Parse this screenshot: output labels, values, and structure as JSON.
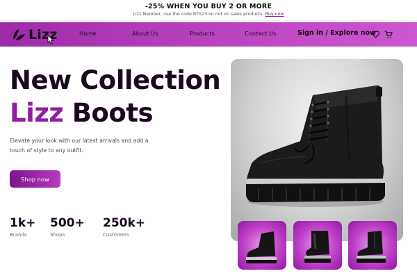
{
  "promo": {
    "title": "-25% WHEN YOU BUY 2 OR MORE",
    "message": "Lizz Member, use the code BTS23 on not on sales products.",
    "link_label": "Buy now"
  },
  "nav": {
    "brand": "Lizz",
    "links": [
      "Home",
      "About Us",
      "Products",
      "Contact Us"
    ],
    "sign_in": "Sign in",
    "separator": "/",
    "explore": "Explore now",
    "icons": [
      "heart-icon",
      "cart-icon"
    ]
  },
  "hero": {
    "title_line1": "New Collection",
    "title_accent": "Lizz",
    "title_rest": "Boots",
    "description": "Elevate your look with our latest arrivals and add a touch of style to any outfit.",
    "cta_label": "Shop now"
  },
  "stats": [
    {
      "value": "1k+",
      "label": "Brands"
    },
    {
      "value": "500+",
      "label": "Shops"
    },
    {
      "value": "250k+",
      "label": "Customers"
    }
  ],
  "colors": {
    "accent": "#8f1fa0",
    "nav_gradient_start": "#9d2aa8",
    "nav_gradient_end": "#cc57d0",
    "thumb_background": "#bf3fc8",
    "hero_card_background": "#d9d9d9"
  }
}
